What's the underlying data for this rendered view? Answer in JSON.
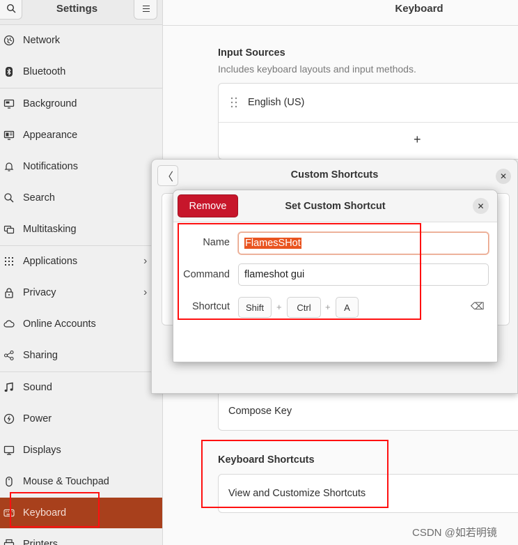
{
  "sidebar": {
    "title": "Settings",
    "items": [
      {
        "label": "Network",
        "icon": "network-icon"
      },
      {
        "label": "Bluetooth",
        "icon": "bluetooth-icon"
      },
      {
        "label": "Background",
        "icon": "background-icon"
      },
      {
        "label": "Appearance",
        "icon": "appearance-icon"
      },
      {
        "label": "Notifications",
        "icon": "bell-icon"
      },
      {
        "label": "Search",
        "icon": "search-icon"
      },
      {
        "label": "Multitasking",
        "icon": "multitasking-icon"
      },
      {
        "label": "Applications",
        "icon": "grid-icon"
      },
      {
        "label": "Privacy",
        "icon": "lock-icon"
      },
      {
        "label": "Online Accounts",
        "icon": "cloud-icon"
      },
      {
        "label": "Sharing",
        "icon": "share-icon"
      },
      {
        "label": "Sound",
        "icon": "music-note-icon"
      },
      {
        "label": "Power",
        "icon": "power-icon"
      },
      {
        "label": "Displays",
        "icon": "display-icon"
      },
      {
        "label": "Mouse & Touchpad",
        "icon": "mouse-icon"
      },
      {
        "label": "Keyboard",
        "icon": "keyboard-icon"
      },
      {
        "label": "Printers",
        "icon": "printer-icon"
      }
    ],
    "active_item": "Keyboard",
    "chevron": "›"
  },
  "main": {
    "title": "Keyboard",
    "input_sources": {
      "title": "Input Sources",
      "subtitle": "Includes keyboard layouts and input methods.",
      "source": "English (US)",
      "add_symbol": "+"
    },
    "compose_key": "Compose Key",
    "keyboard_shortcuts": {
      "title": "Keyboard Shortcuts",
      "row": "View and Customize Shortcuts"
    }
  },
  "custom_shortcuts_dialog": {
    "title": "Custom Shortcuts",
    "back_symbol": "〈",
    "close_symbol": "✕"
  },
  "set_shortcut_dialog": {
    "remove_label": "Remove",
    "title": "Set Custom Shortcut",
    "close_symbol": "✕",
    "name_label": "Name",
    "name_value": "FlamesSHot",
    "command_label": "Command",
    "command_value": "flameshot gui",
    "shortcut_label": "Shortcut",
    "keys": [
      "Shift",
      "Ctrl",
      "A"
    ],
    "plus": "+",
    "backspace_symbol": "⌫"
  },
  "colors": {
    "accent": "#e95420",
    "active_sidebar": "#a8401c",
    "remove_button": "#c7162b",
    "annotation": "#ff1010"
  },
  "watermark": "CSDN @如若明镜"
}
